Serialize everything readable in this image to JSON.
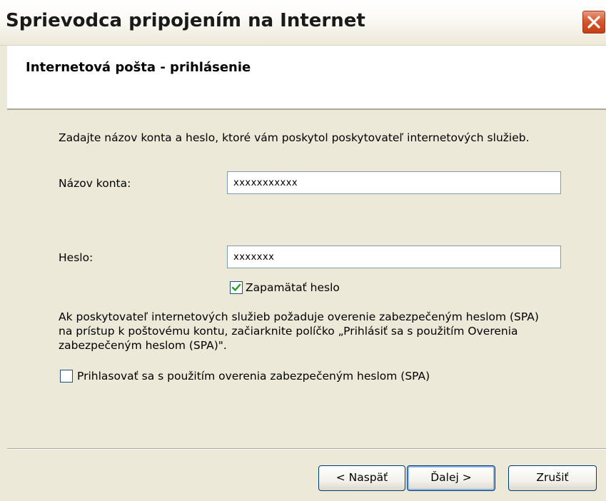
{
  "window": {
    "title": "Sprievodca pripojením na Internet"
  },
  "header": {
    "title": "Internetová pošta - prihlásenie"
  },
  "form": {
    "intro": "Zadajte názov konta a heslo, ktoré vám poskytol poskytovateľ internetových služieb.",
    "account_label": "Názov konta:",
    "account_value": "xxxxxxxxxxx",
    "password_label": "Heslo:",
    "password_value": "xxxxxxx",
    "remember_label": "Zapamätať heslo",
    "remember_checked": true,
    "spa_text_line1": "Ak poskytovateľ internetových služieb požaduje overenie zabezpečeným heslom (SPA)",
    "spa_text_line2": "na prístup k poštovému kontu, začiarknite políčko „Prihlásiť sa s použitím Overenia",
    "spa_text_line3": "zabezpečeným heslom (SPA)\".",
    "spa_checkbox_label": "Prihlasovať sa s použitím overenia zabezpečeným heslom (SPA)",
    "spa_checked": false
  },
  "buttons": {
    "back": "< Naspäť",
    "next_prefix": "",
    "next": "Ďalej >",
    "cancel": "Zrušiť"
  },
  "colors": {
    "dialog_bg": "#ece9d8",
    "close_button": "#d8572e",
    "input_border": "#7f9db9",
    "check_mark": "#21a121"
  }
}
